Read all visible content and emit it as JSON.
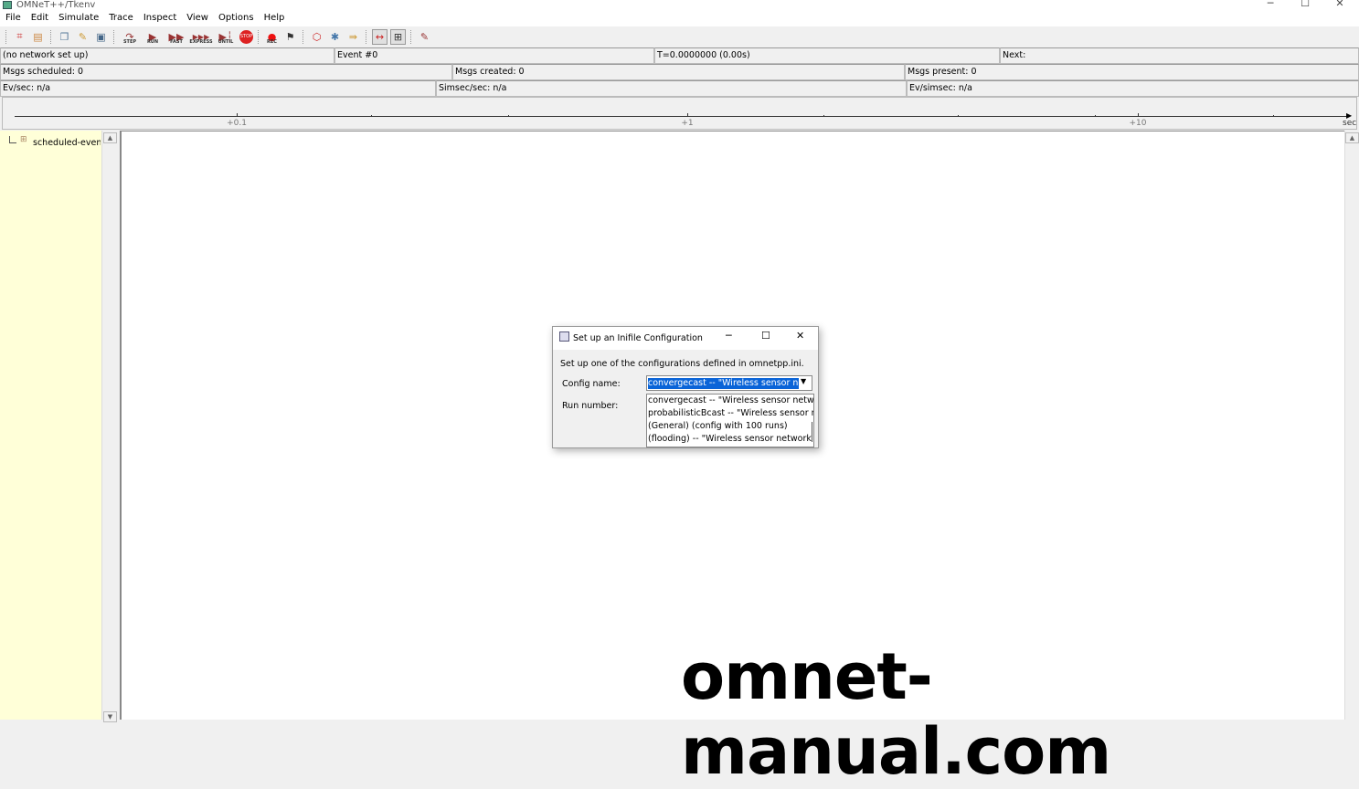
{
  "window": {
    "title": "OMNeT++/Tkenv",
    "controls": [
      "─",
      "☐",
      "✕"
    ]
  },
  "menu": [
    "File",
    "Edit",
    "Simulate",
    "Trace",
    "Inspect",
    "View",
    "Options",
    "Help"
  ],
  "toolbar": {
    "step": "STEP",
    "run": "RUN",
    "fast": "FAST",
    "express": "EXPRESS",
    "until": "UNTIL",
    "stop": "STOP",
    "rec": "REC"
  },
  "status": {
    "row1": [
      "(no network set up)",
      "Event #0",
      "T=0.0000000 (0.00s)",
      "Next:"
    ],
    "row2": [
      "Msgs scheduled: 0",
      "Msgs created: 0",
      "Msgs present: 0"
    ],
    "row3": [
      "Ev/sec: n/a",
      "Simsec/sec: n/a",
      "Ev/simsec: n/a"
    ]
  },
  "timeline": {
    "labels": [
      "+0.1",
      "+1",
      "+10"
    ],
    "unit": "sec"
  },
  "tree": {
    "item": "scheduled-events"
  },
  "dialog": {
    "title": "Set up an Inifile Configuration",
    "description": "Set up one of the configurations defined in omnetpp.ini.",
    "config_label": "Config name:",
    "run_label": "Run number:",
    "config_value": "convergecast -- \"Wireless sensor network\"",
    "options": [
      "convergecast -- \"Wireless sensor network\"",
      "probabilisticBcast -- \"Wireless sensor network\"",
      "(General) (config with 100 runs)",
      "(flooding) -- \"Wireless sensor network v"
    ]
  },
  "watermark": "omnet-manual.com"
}
